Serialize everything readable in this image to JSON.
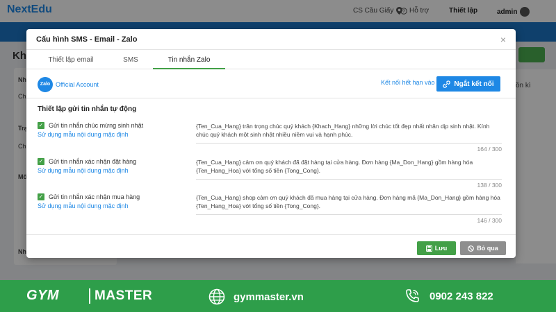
{
  "app": {
    "logo": "NextEdu",
    "branch": "CS Cầu Giấy",
    "support": "Hỗ trợ",
    "settings": "Thiết lập",
    "user": "admin"
  },
  "background": {
    "page_title": "Kha",
    "panel_rows": [
      "Nhá",
      "Chi",
      "Trạ",
      "Chi",
      "Mố",
      "Nh"
    ],
    "right_text": "ồn kì"
  },
  "modal": {
    "title": "Cấu hình SMS - Email - Zalo",
    "close": "×",
    "tabs": [
      {
        "label": "Thiết lập email"
      },
      {
        "label": "SMS"
      },
      {
        "label": "Tin nhắn Zalo"
      }
    ],
    "zalo": {
      "logo_text": "Zalo",
      "oa_label": "Official Account",
      "expire_link": "Kết nối hết hạn vào",
      "disconnect_label": "Ngắt kết nối"
    },
    "section_title": "Thiết lập gửi tin nhắn tự động",
    "messages": [
      {
        "label": "Gửi tin nhắn chúc mừng sinh nhật",
        "default_link": "Sử dụng mẫu nội dung mặc định",
        "text": "{Ten_Cua_Hang} trân trọng chúc quý khách {Khach_Hang} những lời chúc tốt đẹp nhất nhân dịp sinh nhật. Kính chúc quý khách một sinh nhật nhiều niềm vui và hạnh phúc.",
        "count": "164 / 300"
      },
      {
        "label": "Gửi tin nhắn xác nhận đặt hàng",
        "default_link": "Sử dụng mẫu nội dung mặc định",
        "text": "{Ten_Cua_Hang} cảm ơn quý khách đã đặt hàng tại cửa hàng. Đơn hàng {Ma_Don_Hang} gồm hàng hóa {Ten_Hang_Hoa} với tổng số tiền {Tong_Cong}.",
        "count": "138 / 300"
      },
      {
        "label": "Gửi tin nhắn xác nhận mua hàng",
        "default_link": "Sử dụng mẫu nội dung mặc định",
        "text": "{Ten_Cua_Hang} shop cảm ơn quý khách đã mua hàng tại cửa hàng. Đơn hàng mã {Ma_Don_Hang} gồm hàng hóa {Ten_Hang_Hoa} với tổng số tiền {Tong_Cong}.",
        "count": "146 / 300"
      }
    ],
    "save_label": "Lưu",
    "skip_label": "Bỏ qua"
  },
  "banner": {
    "brand_left": "GYM",
    "brand_right": "MASTER",
    "website": "gymmaster.vn",
    "phone": "0902 243 822"
  },
  "colors": {
    "primary_blue": "#1e88e5",
    "nav_blue": "#1c76c5",
    "green": "#43a047",
    "banner_green": "#2e9e4a",
    "grey_button": "#8e8e8e"
  }
}
